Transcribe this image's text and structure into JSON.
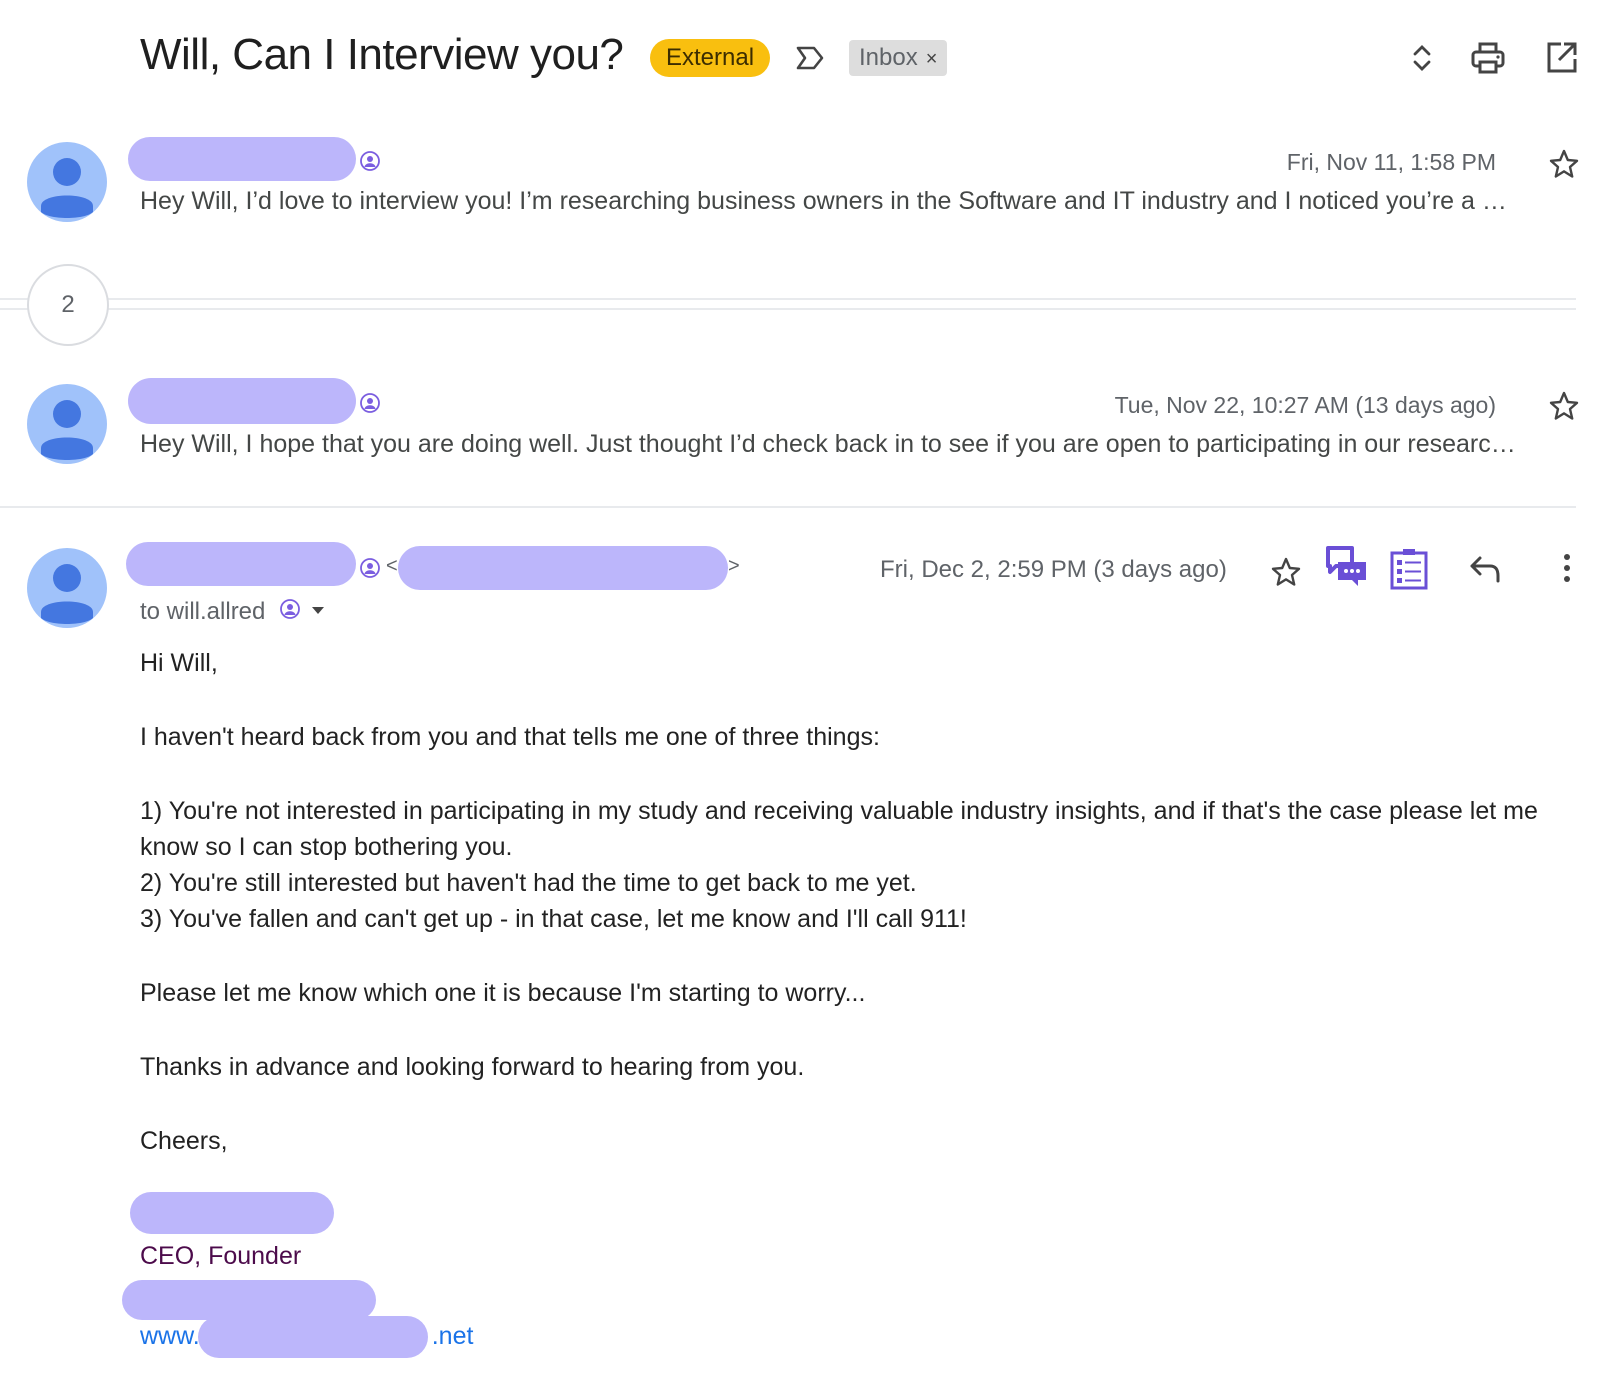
{
  "thread": {
    "subject": "Will, Can I Interview you?",
    "labels": [
      {
        "name": "External",
        "color": "#f9bf0f"
      },
      {
        "name": "Inbox",
        "removable": true,
        "remove_glyph": "×"
      }
    ],
    "toolbar_icons": [
      "expand-collapse-icon",
      "print-icon",
      "open-new-window-icon"
    ]
  },
  "messages": [
    {
      "sender": "[redacted]",
      "date": "Fri, Nov 11, 1:58 PM",
      "snippet": "Hey Will, I’d love to interview you! I’m researching business owners in the Software and IT industry and I noticed you’re a …",
      "starred": false
    },
    {
      "collapsed_count": "2"
    },
    {
      "sender": "[redacted]",
      "date": "Tue, Nov 22, 10:27 AM (13 days ago)",
      "snippet": "Hey Will, I hope that you are doing well. Just thought I’d check back in to see if you are open to participating in our researc…",
      "starred": false
    },
    {
      "sender": "[redacted]",
      "email_open": "<",
      "email_close": ">",
      "date": "Fri, Dec 2, 2:59 PM (3 days ago)",
      "recipient": "to will.allred",
      "starred": false,
      "body": {
        "greeting": "Hi Will,",
        "intro": "I haven't heard back from you and that tells me one of three things:",
        "items": [
          "1) You're not interested in participating in my study and receiving valuable industry insights, and if that's the case please let me know so I can stop bothering you.",
          "2) You're still interested but haven't had the time to get back to me yet.",
          "3) You've fallen and can't get up - in that case, let me know and I'll call 911!"
        ],
        "para1": "Please let me know which one it is because I'm starting to worry...",
        "para2": "Thanks in advance and looking forward to hearing from you.",
        "closing": "Cheers,",
        "signature_title": "CEO, Founder",
        "website_prefix": "www.",
        "website_suffix": ".net"
      }
    }
  ]
}
